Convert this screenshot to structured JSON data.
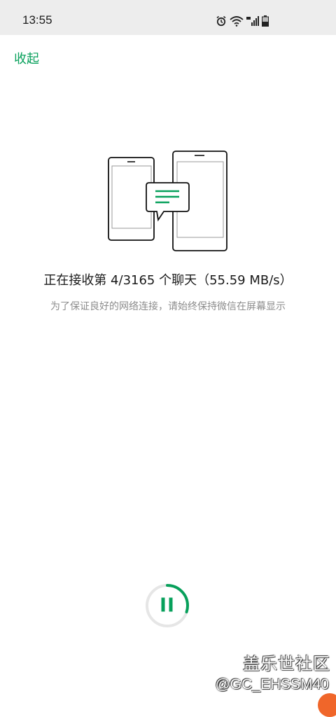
{
  "status_bar": {
    "time": "13:55",
    "icons": [
      "alarm-icon",
      "wifi-icon",
      "lte-signal-icon",
      "battery-icon"
    ]
  },
  "header": {
    "collapse_label": "收起"
  },
  "transfer": {
    "status_text": "正在接收第 4/3165 个聊天（55.59 MB/s）",
    "hint_text": "为了保证良好的网络连接，请始终保持微信在屏幕显示",
    "progress_fraction": 0.3
  },
  "watermark": {
    "brand": "盖乐世社区",
    "user_id": "@GC_EHSSM40"
  },
  "colors": {
    "accent": "#07a05b",
    "ring_track": "#e6e6e6",
    "status_bar_bg": "#ededed",
    "text_primary": "#1a1a1a",
    "text_secondary": "#8c8c8c"
  }
}
